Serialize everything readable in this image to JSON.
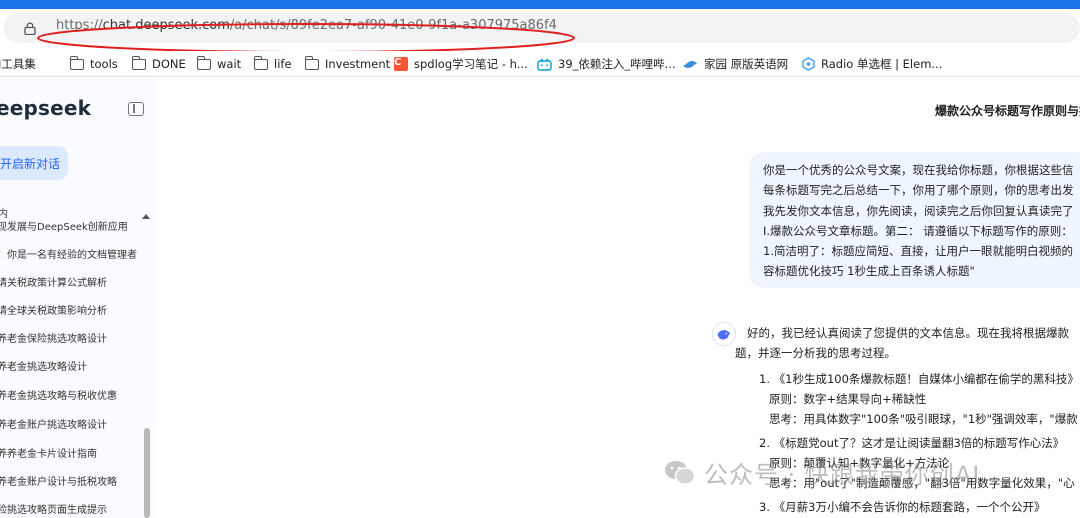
{
  "browser": {
    "url_host": "chat.deepseek.com",
    "url_prefix": "https://",
    "url_path": "/a/chat/s/89fe2ea7-af90-41e0-9f1a-a307975a86f4",
    "annotation_color": "#e02020"
  },
  "bookmarks": [
    {
      "label": "I工具集",
      "icon": "none"
    },
    {
      "label": "tools",
      "icon": "folder-icon"
    },
    {
      "label": "DONE",
      "icon": "folder-icon"
    },
    {
      "label": "wait",
      "icon": "folder-icon"
    },
    {
      "label": "life",
      "icon": "folder-icon"
    },
    {
      "label": "Investment",
      "icon": "folder-icon"
    },
    {
      "label": "spdlog学习笔记 - h...",
      "icon": "csdn-icon"
    },
    {
      "label": "39_依赖注入_哔哩哔...",
      "icon": "bilibili-icon"
    },
    {
      "label": "家园 原版英语网",
      "icon": "bird-icon"
    },
    {
      "label": "Radio 单选框 | Elem...",
      "icon": "element-icon"
    }
  ],
  "sidebar": {
    "logo": "eepseek",
    "new_chat_label": "开启新对话",
    "section_header": "内",
    "history": [
      "现发展与DeepSeek创新应用",
      "：你是一名有经验的文档管理者",
      "请关税政策计算公式解析",
      "请全球关税政策影响分析",
      "养老金保险挑选攻略设计",
      "养老金挑选攻略设计",
      "养老金挑选攻略与税收优惠",
      "养老金账户挑选攻略设计",
      "养养老金卡片设计指南",
      "养老金账户设计与抵税攻略",
      "险挑选攻略页面生成提示"
    ]
  },
  "chat": {
    "title": "爆款公众号标题写作原则与技巧",
    "user_message_lines": [
      "你是一个优秀的公众号文案，现在我给你标题，你根据这些信",
      "每条标题写完之后总结一下，你用了哪个原则，你的思考出发",
      "我先发你文本信息，你先阅读，阅读完之后你回复认真读完了",
      "I.爆款公众号文章标题。第二： 请遵循以下标题写作的原则：",
      "1.简洁明了：标题应简短、直接，让用户一眼就能明白视频的",
      "容标题优化技巧  1秒生成上百条诱人标题\""
    ],
    "reply_intro": [
      "好的，我已经认真阅读了您提供的文本信息。现在我将根据爆款",
      "题，并逐一分析我的思考过程。"
    ],
    "items": [
      {
        "title": "1. 《1秒生成100条爆款标题！自媒体小编都在偷学的黑科技》",
        "principle": "原则：数字+结果导向+稀缺性",
        "thinking": "思考：用具体数字\"100条\"吸引眼球，\"1秒\"强调效率，\"爆款"
      },
      {
        "title": "2. 《标题党out了？这才是让阅读量翻3倍的标题写作心法》",
        "principle": "原则：颠覆认知+数字量化+方法论",
        "thinking": "思考：用\"out了\"制造颠覆感，\"翻3倍\"用数字量化效果，\"心"
      },
      {
        "title": "3. 《月薪3万小编不会告诉你的标题套路，一个个公开》",
        "principle": "",
        "thinking": ""
      }
    ]
  },
  "watermark": "公众号 · 快跟我带你创AI",
  "colors": {
    "accent": "#2563eb",
    "bubble": "#eff6ff",
    "sidebar_bg": "#f9fbff"
  }
}
